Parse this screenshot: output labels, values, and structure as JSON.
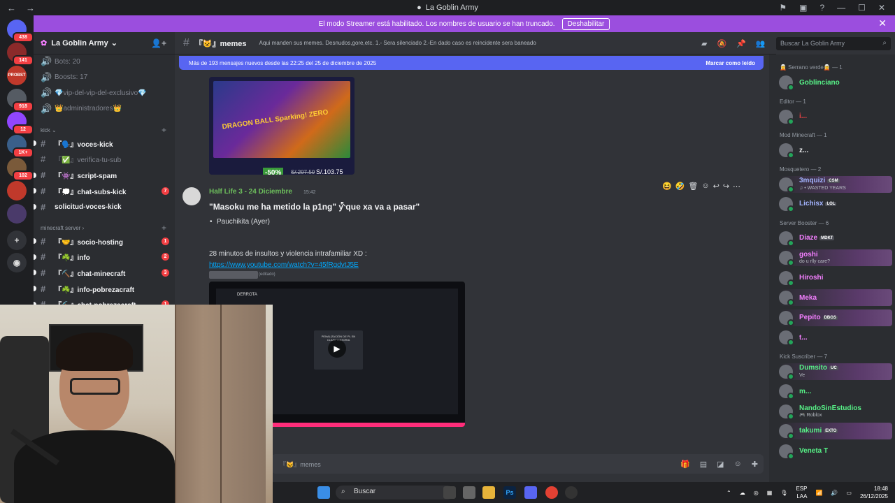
{
  "window": {
    "title": "La Goblin Army"
  },
  "banner": {
    "text": "El modo Streamer está habilitado. Los nombres de usuario se han truncado.",
    "button": "Deshabilitar"
  },
  "guilds": [
    {
      "badge": "438",
      "color": "#5865f2",
      "icon": "discord-logo-icon"
    },
    {
      "badge": "141",
      "color": "#8b2a2a"
    },
    {
      "badge": "",
      "color": "#c0392b",
      "label": "PROBST"
    },
    {
      "badge": "918",
      "color": "#555b63"
    },
    {
      "badge": "12",
      "color": "#9146ff",
      "icon": "twitch-icon"
    },
    {
      "badge": "1K+",
      "color": "#3a5f8a"
    },
    {
      "badge": "102",
      "color": "#7a5a3a"
    },
    {
      "badge": "",
      "color": "#c0392b"
    },
    {
      "badge": "",
      "color": "#4a3a6a"
    }
  ],
  "server": {
    "name": "La Goblin Army",
    "items": [
      {
        "label": "Bots: 20"
      },
      {
        "label": "Boosts: 17"
      },
      {
        "label": "💎vip-del-vip-del-exclusivo💎"
      },
      {
        "label": "👑administradores👑"
      }
    ],
    "cat_kick": "kick",
    "kick_channels": [
      {
        "label": "『🗣️』voces-kick",
        "unread": true,
        "count": ""
      },
      {
        "label": "『✅』verifica-tu-sub",
        "unread": false,
        "count": ""
      },
      {
        "label": "『👾』script-spam",
        "unread": true,
        "count": ""
      },
      {
        "label": "『💭』chat-subs-kick",
        "unread": true,
        "count": "7"
      },
      {
        "label": "solicitud-voces-kick",
        "unread": true,
        "count": ""
      }
    ],
    "cat_mc": "minecraft server",
    "mc_channels": [
      {
        "label": "『🤝』socio-hosting",
        "unread": true,
        "count": "1"
      },
      {
        "label": "『☘️』info",
        "unread": true,
        "count": "2"
      },
      {
        "label": "『⛏️』chat-minecraft",
        "unread": true,
        "count": "3"
      },
      {
        "label": "『☘️』info-pobrezacraft",
        "unread": true,
        "count": ""
      },
      {
        "label": "『⛏️』chat-pobrezacraft",
        "unread": true,
        "count": "1"
      }
    ]
  },
  "channel": {
    "name": "『😺』memes",
    "topic": "Aqui manden sus memes. Desnudos,gore,etc. 1.- Sera silenciado 2.-En dado caso es reincidente sera baneado",
    "search_placeholder": "Buscar La Goblin Army",
    "new_messages": "Más de 193 mensajes nuevos desde las 22:25 del 25 de diciembre de 2025",
    "mark_read": "Marcar como leído"
  },
  "embed": {
    "logo": "DRAGON BALL Sparking! ZERO",
    "discount": "-50%",
    "old_price": "S/.207.50",
    "price": "S/.103.75"
  },
  "message": {
    "author": "Half Life 3 - 24 Diciembre",
    "time": "15:42",
    "title": "\"Masoku me ha metido la p1ng\" y que xa va a pasar\"",
    "bullet": "Pauchikita (Ayer)",
    "line": "28 minutos de insultos y violencia intrafamiliar XD :",
    "link": "https://www.youtube.com/watch?v=45fRgdvtJ5E",
    "edited": "(editado)",
    "video_title": "DERROTA",
    "video_modal": "PENALIZACIÓN DE PL EN CLASIFICATORIA"
  },
  "composer": {
    "placeholder": "『😺』memes"
  },
  "members": {
    "groups": [
      {
        "title": "🧝 Serrano verde🧝 — 1",
        "members": [
          {
            "name": "Goblinciano",
            "color": "#57f287",
            "sub": ""
          }
        ]
      },
      {
        "title": "Editor — 1",
        "members": [
          {
            "name": "i...",
            "color": "#ed4245",
            "sub": ""
          }
        ]
      },
      {
        "title": "Mod Minecraft — 1",
        "members": [
          {
            "name": "z...",
            "color": "#f2f3f5",
            "sub": ""
          }
        ]
      },
      {
        "title": "Mosquetero — 2",
        "members": [
          {
            "name": "3mquizi",
            "color": "#a4b4ff",
            "sub": "♫ • WASTED YEARS",
            "tag": "CSM"
          },
          {
            "name": "Lichisx",
            "color": "#a4b4ff",
            "sub": "",
            "tag": "LOL"
          }
        ]
      },
      {
        "title": "Server Booster — 6",
        "members": [
          {
            "name": "Diaze",
            "color": "#f47fff",
            "sub": "",
            "tag": "MDKT"
          },
          {
            "name": "goshi",
            "color": "#f47fff",
            "sub": "do u rlly care?"
          },
          {
            "name": "Hiroshi",
            "color": "#f47fff",
            "sub": ""
          },
          {
            "name": "Meka",
            "color": "#f47fff",
            "sub": ""
          },
          {
            "name": "Pepito",
            "color": "#f47fff",
            "sub": "",
            "tag": "DBGS"
          },
          {
            "name": "t...",
            "color": "#f47fff",
            "sub": ""
          }
        ]
      },
      {
        "title": "Kick Suscriber — 7",
        "members": [
          {
            "name": "Dumsito",
            "color": "#57f287",
            "sub": "Ve",
            "tag": "UC"
          },
          {
            "name": "m...",
            "color": "#57f287",
            "sub": ""
          },
          {
            "name": "NandoSinEstudios",
            "color": "#57f287",
            "sub": "🎮 Roblox"
          },
          {
            "name": "takumi",
            "color": "#57f287",
            "sub": "",
            "tag": "EXTO"
          },
          {
            "name": "Veneta T",
            "color": "#57f287",
            "sub": ""
          }
        ]
      }
    ]
  },
  "taskbar": {
    "search": "Buscar",
    "lang1": "ESP",
    "lang2": "LAA",
    "time": "18:48",
    "date": "26/12/2025"
  },
  "colors": {
    "accent": "#5865f2",
    "banner": "#9b4ede",
    "green": "#23a55a"
  }
}
